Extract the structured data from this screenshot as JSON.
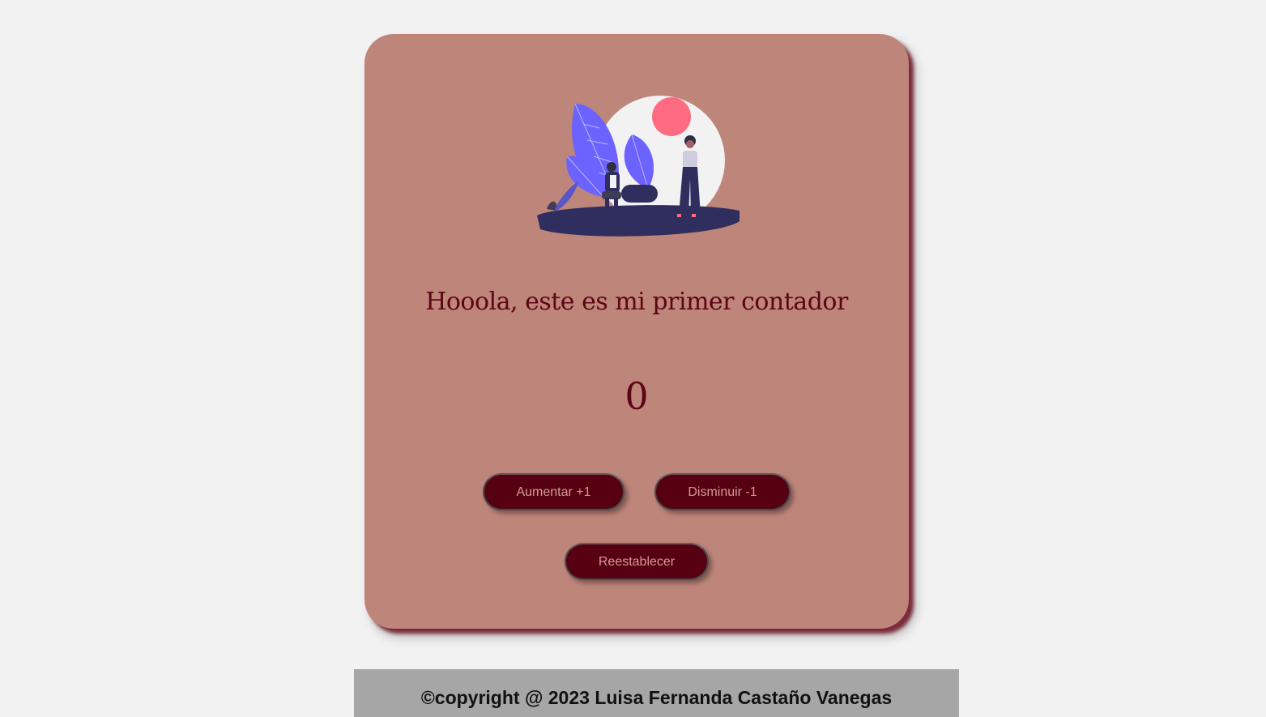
{
  "card": {
    "background_color": "#be857a",
    "illustration_icon": "people-with-plants-illustration",
    "title": "Hooola, este es mi primer contador",
    "counter_value": "0"
  },
  "buttons": {
    "increment_label": "Aumentar +1",
    "decrement_label": "Disminuir -1",
    "reset_label": "Reestablecer",
    "background_color": "#560012",
    "text_color": "#d69a95"
  },
  "footer": {
    "text": "©copyright @ 2023 Luisa Fernanda Castaño Vanegas",
    "background_color": "#a6a6a6"
  }
}
